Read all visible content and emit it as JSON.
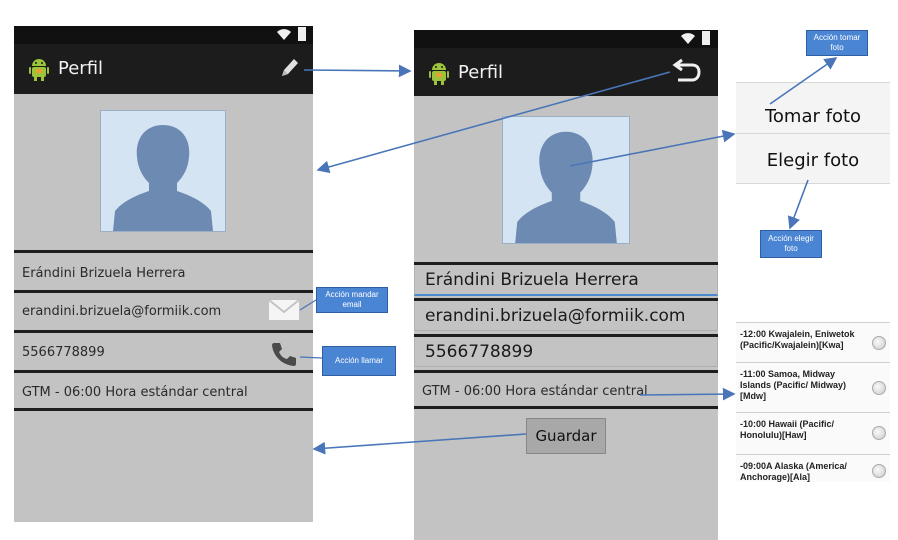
{
  "left_screen": {
    "title": "Perfil",
    "name": "Erándini Brizuela Herrera",
    "email": "erandini.brizuela@formiik.com",
    "phone": "5566778899",
    "timezone": "GTM - 06:00 Hora estándar central"
  },
  "middle_screen": {
    "title": "Perfil",
    "name": "Erándini Brizuela Herrera",
    "email": "erandini.brizuela@formiik.com",
    "phone": "5566778899",
    "timezone": "GTM - 06:00 Hora estándar central",
    "save_label": "Guardar"
  },
  "photo_menu": {
    "items": [
      "Tomar foto",
      "Elegir foto"
    ]
  },
  "timezone_list": {
    "items": [
      "-12:00  Kwajalein, Eniwetok (Pacific/Kwajalein)[Kwa]",
      "-11:00  Samoa, Midway Islands (Pacific/ Midway)[Mdw]",
      "-10:00  Hawaii (Pacific/ Honolulu)[Haw]",
      "-09:00A Alaska (America/ Anchorage)[Ala]"
    ]
  },
  "callouts": {
    "take_photo": "Acción tomar foto",
    "choose_photo": "Acción elegir foto",
    "send_email": "Acción mandar email",
    "call": "Acción llamar"
  },
  "icons": {
    "app": "android-icon",
    "edit": "pencil-icon",
    "back": "undo-arrow-icon",
    "email": "envelope-icon",
    "phone": "phone-icon",
    "wifi": "wifi-icon",
    "battery": "battery-icon"
  },
  "colors": {
    "screen_bg": "#c3c3c3",
    "action_bar": "#1c1c1c",
    "callout": "#4a85d4",
    "arrow": "#4a75b8"
  }
}
